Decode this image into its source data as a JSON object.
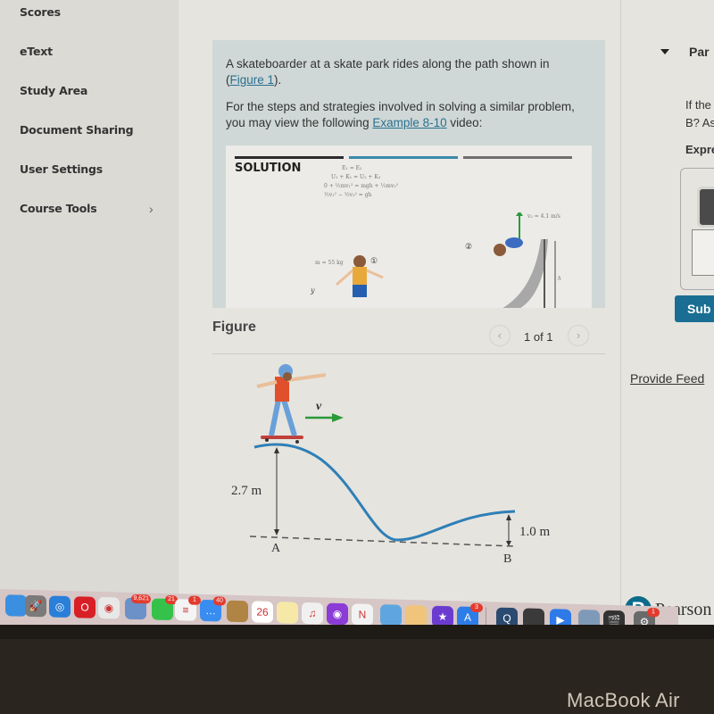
{
  "sidebar": {
    "items": [
      {
        "label": "Scores"
      },
      {
        "label": "eText"
      },
      {
        "label": "Study Area"
      },
      {
        "label": "Document Sharing"
      },
      {
        "label": "User Settings"
      },
      {
        "label": "Course Tools",
        "has_submenu": true,
        "chevron": "›"
      }
    ]
  },
  "problem": {
    "intro_text": "A skateboarder at a skate park rides along the path shown in",
    "figure_link_open": "(",
    "figure_link": "Figure 1",
    "figure_link_close": ").",
    "strategy_text": "For the steps and strategies involved in solving a similar problem, you may view the following",
    "example_link": "Example 8-10",
    "strategy_suffix": "video:",
    "video": {
      "solution_label": "SOLUTION",
      "equations": [
        "E₁ = E₂",
        "U₁ + K₁ = U₂ + K₂",
        "0 + ½mv₁² = mgh + ½mv₂²",
        "½v₁² − ½v₂² = gh"
      ],
      "mass_label": "m = 55 kg",
      "velocity_label": "v₂ = 4.1 m/s",
      "height_label": "h",
      "axis_label": "y",
      "point1": "①",
      "point2": "②",
      "progress_bar_colors": [
        "#2b2b2b",
        "#3a8aa8",
        "#6e6e6e"
      ]
    }
  },
  "figure_panel": {
    "title": "Figure",
    "prev_icon": "‹",
    "next_icon": "›",
    "page_indicator": "1 of 1",
    "diagram": {
      "velocity_label": "v",
      "height_a": "2.7 m",
      "height_b": "1.0 m",
      "point_a": "A",
      "point_b": "B",
      "track_color": "#2f7fb6",
      "arrow_color": "#2a9a3a"
    }
  },
  "part_panel": {
    "part_label": "Par",
    "question_line1": "If the",
    "question_line2": "B? As",
    "express_label": "Expre",
    "submit_label": "Sub",
    "feedback_link": "Provide Feed"
  },
  "branding": {
    "pearson_logo": "P",
    "pearson_text": "Pearson"
  },
  "dock": {
    "icons": [
      {
        "name": "finder-icon",
        "color": "#3b8fe0",
        "glyph": ""
      },
      {
        "name": "launchpad-icon",
        "color": "#7a7a7a",
        "glyph": "🚀"
      },
      {
        "name": "safari-icon",
        "color": "#2a7fd8",
        "glyph": "◎"
      },
      {
        "name": "opera-icon",
        "color": "#d81f26",
        "glyph": "O"
      },
      {
        "name": "chrome-icon",
        "color": "#e8e8e8",
        "glyph": "◉"
      },
      {
        "name": "preview-icon",
        "color": "#6c90c8",
        "glyph": "",
        "badge": "9,621"
      },
      {
        "name": "facetime-icon",
        "color": "#35c24b",
        "glyph": "",
        "badge": "21"
      },
      {
        "name": "reminders-icon",
        "color": "#f4f4f4",
        "glyph": "≡",
        "badge": "1"
      },
      {
        "name": "messages-icon",
        "color": "#3a8df0",
        "glyph": "…",
        "badge": "40"
      },
      {
        "name": "contacts-icon",
        "color": "#b08444",
        "glyph": ""
      },
      {
        "name": "calendar-icon",
        "color": "#ffffff",
        "glyph": "26"
      },
      {
        "name": "notes-icon",
        "color": "#f6e9a8",
        "glyph": ""
      },
      {
        "name": "music-icon",
        "color": "#f0f0f0",
        "glyph": "♫"
      },
      {
        "name": "podcasts-icon",
        "color": "#8b3bd6",
        "glyph": "◉"
      },
      {
        "name": "news-icon",
        "color": "#f2f2f2",
        "glyph": "N"
      },
      {
        "name": "keynote-icon",
        "color": "#5fa6e0",
        "glyph": ""
      },
      {
        "name": "pages-icon",
        "color": "#f0c47a",
        "glyph": ""
      },
      {
        "name": "imovie-icon",
        "color": "#6b3bd0",
        "glyph": "★"
      },
      {
        "name": "app-store-icon",
        "color": "#2d7de8",
        "glyph": "A",
        "badge": "3"
      },
      {
        "name": "quicktime-icon",
        "color": "#2a4a70",
        "glyph": "Q"
      },
      {
        "name": "photo-booth-icon",
        "color": "#3a3a3a",
        "glyph": ""
      },
      {
        "name": "zoom-icon",
        "color": "#2d7ae8",
        "glyph": "▶"
      },
      {
        "name": "image-capture-icon",
        "color": "#7f9ab8",
        "glyph": ""
      },
      {
        "name": "final-cut-icon",
        "color": "#333333",
        "glyph": "🎬"
      },
      {
        "name": "system-preferences-icon",
        "color": "#6a6a6a",
        "glyph": "⚙",
        "badge": "1"
      }
    ]
  },
  "hardware": {
    "label": "MacBook Air"
  }
}
